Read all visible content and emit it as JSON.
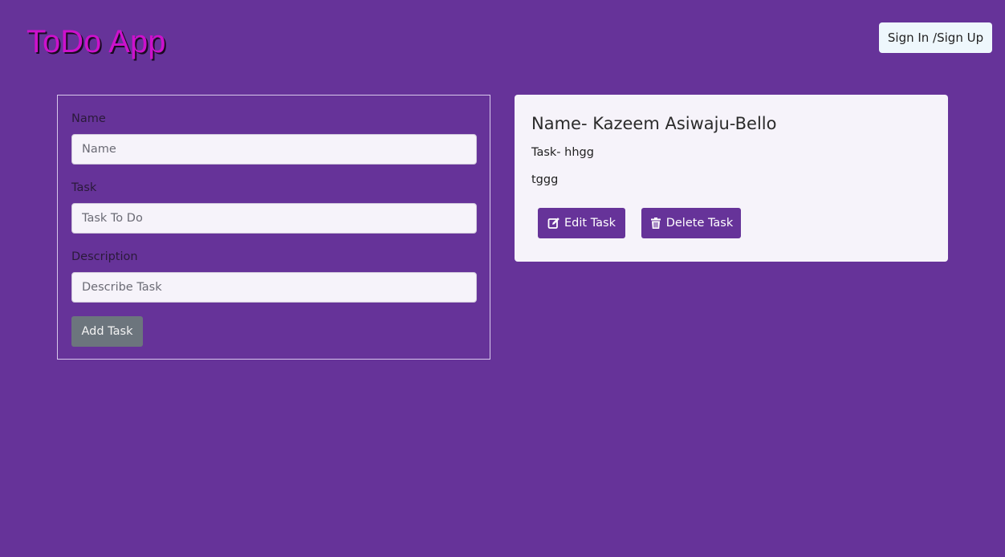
{
  "header": {
    "logo": "ToDo App",
    "auth_button": "Sign In /Sign Up"
  },
  "form": {
    "name_label": "Name",
    "name_placeholder": "Name",
    "task_label": "Task",
    "task_placeholder": "Task To Do",
    "description_label": "Description",
    "description_placeholder": "Describe Task",
    "submit_label": "Add Task"
  },
  "tasks": [
    {
      "name": "Name- Kazeem Asiwaju-Bello",
      "task": "Task- hhgg",
      "description": "tggg",
      "edit_label": "Edit Task",
      "delete_label": "Delete Task"
    }
  ],
  "colors": {
    "background": "#663399",
    "logo": "#cc11cc",
    "card": "#f6f3fa",
    "primary_button": "#663399",
    "disabled_button": "#6c757d"
  }
}
